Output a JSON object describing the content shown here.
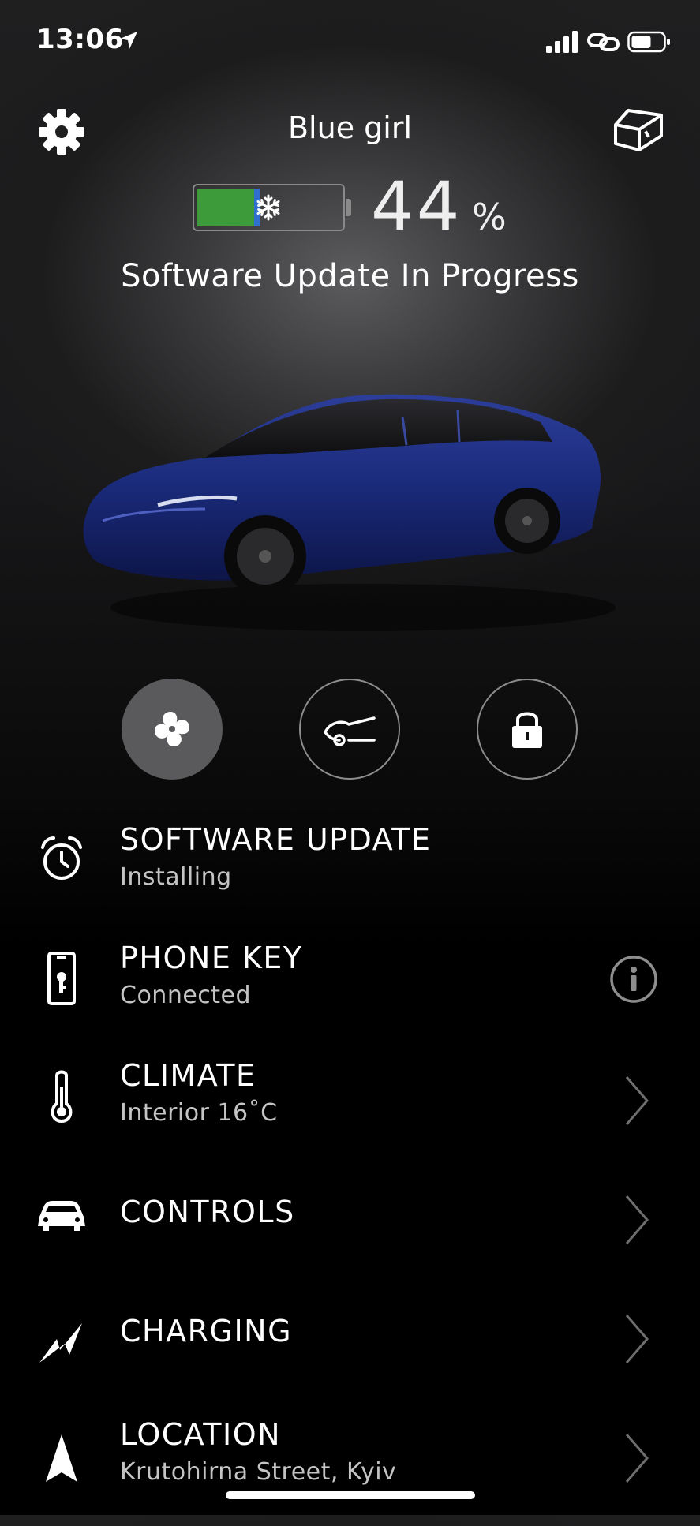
{
  "status_bar": {
    "time": "13:06"
  },
  "header": {
    "car_name": "Blue girl"
  },
  "battery": {
    "percent": "44",
    "percent_sign": "%",
    "fill_fraction": 0.44,
    "fill_color": "#3e9b3a",
    "cold_color": "#2f6fd0"
  },
  "status_message": "Software Update In Progress",
  "quick_actions": [
    {
      "name": "climate-fan",
      "icon": "fan-icon",
      "state": "active"
    },
    {
      "name": "trunk",
      "icon": "trunk-open-icon",
      "state": "inactive"
    },
    {
      "name": "lock",
      "icon": "lock-icon",
      "state": "inactive"
    }
  ],
  "menu": [
    {
      "title": "SOFTWARE UPDATE",
      "subtitle": "Installing",
      "icon": "alarm-clock-icon"
    },
    {
      "title": "PHONE KEY",
      "subtitle": "Connected",
      "icon": "phone-key-icon",
      "accessory": "info-icon"
    },
    {
      "title": "CLIMATE",
      "subtitle": "Interior 16˚C",
      "icon": "thermometer-icon",
      "accessory": "chevron-right-icon"
    },
    {
      "title": "CONTROLS",
      "subtitle": "",
      "icon": "car-icon",
      "accessory": "chevron-right-icon"
    },
    {
      "title": "CHARGING",
      "subtitle": "",
      "icon": "bolt-icon",
      "accessory": "chevron-right-icon"
    },
    {
      "title": "LOCATION",
      "subtitle": "Krutohirna Street, Kyiv",
      "icon": "navigation-arrow-icon",
      "accessory": "chevron-right-icon"
    }
  ],
  "colors": {
    "car_body": "#1a2a7a",
    "accent_grey": "#8d8d8d"
  }
}
